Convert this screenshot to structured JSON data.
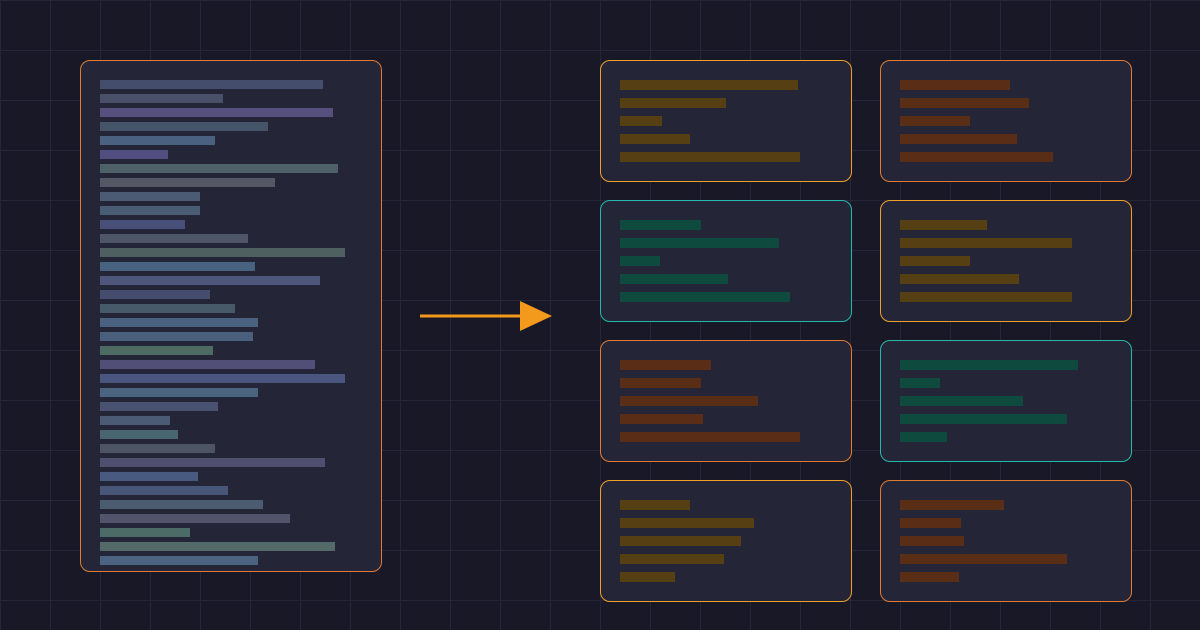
{
  "colors": {
    "background": "#181827",
    "grid": "#262637",
    "panel_fill": "#242638",
    "arrow": "#f39a1c",
    "border_orange": "#e07a35",
    "border_amber": "#f0a02a",
    "border_teal": "#25b8ad",
    "bar_amber": "#573f14",
    "bar_orange": "#5a2e16",
    "bar_green": "#0e4a3e"
  },
  "source_document": {
    "icon": "document-icon",
    "lines": [
      {
        "length": 0.89,
        "color": "#454d6d"
      },
      {
        "length": 0.49,
        "color": "#4a5068"
      },
      {
        "length": 0.93,
        "color": "#56507f"
      },
      {
        "length": 0.67,
        "color": "#455468"
      },
      {
        "length": 0.46,
        "color": "#4a6180"
      },
      {
        "length": 0.27,
        "color": "#524f80"
      },
      {
        "length": 0.95,
        "color": "#4e6068"
      },
      {
        "length": 0.7,
        "color": "#545864"
      },
      {
        "length": 0.4,
        "color": "#4a5b73"
      },
      {
        "length": 0.4,
        "color": "#485c74"
      },
      {
        "length": 0.34,
        "color": "#48507a"
      },
      {
        "length": 0.59,
        "color": "#4e5566"
      },
      {
        "length": 0.98,
        "color": "#4e6160"
      },
      {
        "length": 0.62,
        "color": "#486380"
      },
      {
        "length": 0.88,
        "color": "#4f567c"
      },
      {
        "length": 0.44,
        "color": "#454c6e"
      },
      {
        "length": 0.54,
        "color": "#475a6a"
      },
      {
        "length": 0.63,
        "color": "#4a6180"
      },
      {
        "length": 0.61,
        "color": "#4a5f7b"
      },
      {
        "length": 0.45,
        "color": "#4e6b63"
      },
      {
        "length": 0.86,
        "color": "#514f78"
      },
      {
        "length": 0.98,
        "color": "#4b5680"
      },
      {
        "length": 0.63,
        "color": "#4a6480"
      },
      {
        "length": 0.47,
        "color": "#495270"
      },
      {
        "length": 0.28,
        "color": "#4b5b76"
      },
      {
        "length": 0.31,
        "color": "#486570"
      },
      {
        "length": 0.46,
        "color": "#4d5565"
      },
      {
        "length": 0.9,
        "color": "#4f5070"
      },
      {
        "length": 0.39,
        "color": "#485a80"
      },
      {
        "length": 0.51,
        "color": "#485778"
      },
      {
        "length": 0.65,
        "color": "#4b5c71"
      },
      {
        "length": 0.76,
        "color": "#51546a"
      },
      {
        "length": 0.36,
        "color": "#4d6b66"
      },
      {
        "length": 0.94,
        "color": "#546a68"
      },
      {
        "length": 0.63,
        "color": "#4b6380"
      }
    ]
  },
  "arrow": {
    "icon": "arrow-right-icon"
  },
  "chunks": [
    {
      "border": "border_amber",
      "bar": "bar_amber",
      "lengths": [
        0.84,
        0.5,
        0.2,
        0.33,
        0.85
      ]
    },
    {
      "border": "border_orange",
      "bar": "bar_orange",
      "lengths": [
        0.52,
        0.61,
        0.33,
        0.55,
        0.72
      ]
    },
    {
      "border": "border_teal",
      "bar": "bar_green",
      "lengths": [
        0.38,
        0.75,
        0.19,
        0.51,
        0.8
      ]
    },
    {
      "border": "border_amber",
      "bar": "bar_amber",
      "lengths": [
        0.41,
        0.81,
        0.33,
        0.56,
        0.81
      ]
    },
    {
      "border": "border_orange",
      "bar": "bar_orange",
      "lengths": [
        0.43,
        0.38,
        0.65,
        0.39,
        0.85
      ]
    },
    {
      "border": "border_teal",
      "bar": "bar_green",
      "lengths": [
        0.84,
        0.19,
        0.58,
        0.79,
        0.22
      ]
    },
    {
      "border": "border_amber",
      "bar": "bar_amber",
      "lengths": [
        0.33,
        0.63,
        0.57,
        0.49,
        0.26
      ]
    },
    {
      "border": "border_orange",
      "bar": "bar_orange",
      "lengths": [
        0.49,
        0.29,
        0.3,
        0.79,
        0.28
      ]
    }
  ]
}
